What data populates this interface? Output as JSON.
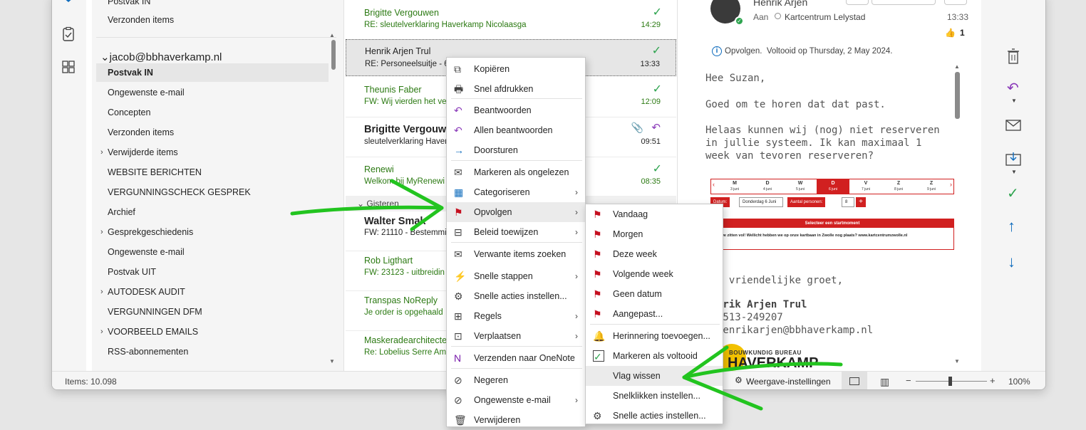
{
  "folders": {
    "top_items": [
      "Postvak IN",
      "Verzonden items"
    ],
    "account": "jacob@bbhaverkamp.nl",
    "items": [
      {
        "label": "Postvak IN",
        "selected": true,
        "expandable": false
      },
      {
        "label": "Ongewenste e-mail",
        "expandable": false
      },
      {
        "label": "Concepten",
        "expandable": false
      },
      {
        "label": "Verzonden items",
        "expandable": false
      },
      {
        "label": "Verwijderde items",
        "expandable": true
      },
      {
        "label": "WEBSITE BERICHTEN",
        "expandable": false
      },
      {
        "label": "VERGUNNINGSCHECK GESPREK",
        "expandable": false
      },
      {
        "label": "Archief",
        "expandable": false
      },
      {
        "label": "Gesprekgeschiedenis",
        "expandable": true
      },
      {
        "label": "Ongewenste e-mail",
        "expandable": false
      },
      {
        "label": "Postvak UIT",
        "expandable": false
      },
      {
        "label": "AUTODESK AUDIT",
        "expandable": true
      },
      {
        "label": "VERGUNNINGEN DFM",
        "expandable": false
      },
      {
        "label": "VOORBEELD EMAILS",
        "expandable": true
      },
      {
        "label": "RSS-abonnementen",
        "expandable": false
      }
    ]
  },
  "mail_list": {
    "group_header": "Gisteren",
    "mails": [
      {
        "from": "Brigitte Vergouwen",
        "subject": "RE: sleutelverklaring Haverkamp Nicolaasga",
        "time": "14:29"
      },
      {
        "from": "Henrik Arjen Trul",
        "subject": "RE: Personeelsuitje - 6",
        "time": "13:33"
      },
      {
        "from": "Theunis Faber",
        "subject": "FW: Wij vierden het ve",
        "time": "12:09"
      },
      {
        "from": "Brigitte Vergouw",
        "subject": "sleutelverklaring Haver",
        "time": "09:51"
      },
      {
        "from": "Renewi",
        "subject": "Welkom bij MyRenewi",
        "time": "08:35"
      },
      {
        "from": "Walter Smak",
        "subject": "FW: 21110 - Bestemmin",
        "time": ""
      },
      {
        "from": "Rob Ligthart",
        "subject": "FW: 23123 - uitbreidin",
        "time": ""
      },
      {
        "from": "Transpas NoReply",
        "subject": "Je order is opgehaald",
        "time": ""
      },
      {
        "from": "Maskeradearchitecten",
        "subject": "Re: Lobelius Serre  Ame",
        "time": ""
      }
    ]
  },
  "reading": {
    "sender": "Henrik Arjen",
    "to_label": "Aan",
    "to": "Kartcentrum Lelystad",
    "time": "13:33",
    "reaction_count": "1",
    "followup": "Opvolgen.  Voltooid op Thursday, 2 May 2024.",
    "greeting": "Hee Suzan,",
    "p1": "Goed om te horen dat dat past.",
    "p2": "Helaas kunnen wij (nog) niet reserveren in jullie systeem. Ik kan maximaal 1 week van tevoren reserveren?",
    "closing": "t vriendelijke groet,",
    "sig_name": "nrik Arjen Trul",
    "sig_phone": "0513-249207",
    "sig_email": "henrikarjen@bbhaverkamp.nl",
    "logo_top": "BOUWKUNDIG BUREAU",
    "logo_main": "HAVERKAMP",
    "embed": {
      "days": [
        {
          "d": "M",
          "date": "3 juni"
        },
        {
          "d": "D",
          "date": "4 juni"
        },
        {
          "d": "W",
          "date": "5 juni"
        },
        {
          "d": "D",
          "date": "6 juni"
        },
        {
          "d": "V",
          "date": "7 juni"
        },
        {
          "d": "Z",
          "date": "8 juni"
        },
        {
          "d": "Z",
          "date": "9 juni"
        }
      ],
      "datum_label": "Datum:",
      "datum_value": "Donderdag 6 Juni",
      "persons_label": "Aantal personen:",
      "persons_value": "8",
      "startmoment": "Selecteer een startmoment",
      "notice": "Jij we zitten vol! Wellicht hebben we op onze kartbaan in Zwolle nog plaats? www.kartcentrumzwolle.nl"
    }
  },
  "context_menu": {
    "items": [
      {
        "label": "Kopiëren",
        "u": "K"
      },
      {
        "label": "Snel afdrukken",
        "u": "f"
      },
      {
        "label": "Beantwoorden",
        "u": "B"
      },
      {
        "label": "Allen beantwoorden",
        "u": "b"
      },
      {
        "label": "Doorsturen",
        "u": "t"
      },
      {
        "label": "Markeren als ongelezen",
        "u": ""
      },
      {
        "label": "Categoriseren",
        "u": "i"
      },
      {
        "label": "Opvolgen",
        "u": "p"
      },
      {
        "label": "Beleid toewijzen",
        "u": "t"
      },
      {
        "label": "Verwante items zoeken",
        "u": "w"
      },
      {
        "label": "Snelle stappen",
        "u": "n"
      },
      {
        "label": "Snelle acties instellen...",
        "u": "S"
      },
      {
        "label": "Regels",
        "u": "g"
      },
      {
        "label": "Verplaatsen",
        "u": "p"
      },
      {
        "label": "Verzenden naar OneNote",
        "u": "N"
      },
      {
        "label": "Negeren",
        "u": "N"
      },
      {
        "label": "Ongewenste e-mail",
        "u": "e"
      },
      {
        "label": "Verwijderen",
        "u": ""
      }
    ]
  },
  "submenu": {
    "items": [
      {
        "label": "Vandaag"
      },
      {
        "label": "Morgen"
      },
      {
        "label": "Deze week"
      },
      {
        "label": "Volgende week"
      },
      {
        "label": "Geen datum"
      },
      {
        "label": "Aangepast..."
      },
      {
        "label": "Herinnering toevoegen..."
      },
      {
        "label": "Markeren als voltooid"
      },
      {
        "label": "Vlag wissen"
      },
      {
        "label": "Snelklikken instellen..."
      },
      {
        "label": "Snelle acties instellen..."
      }
    ]
  },
  "status": {
    "items": "Items: 10.098",
    "view_settings": "Weergave-instellingen",
    "zoom": "100%"
  },
  "colors": {
    "accent": "#0f6cbd",
    "green_unread": "#2c7a13",
    "flag_red": "#c50f1f",
    "arrow_green": "#22c41f"
  }
}
